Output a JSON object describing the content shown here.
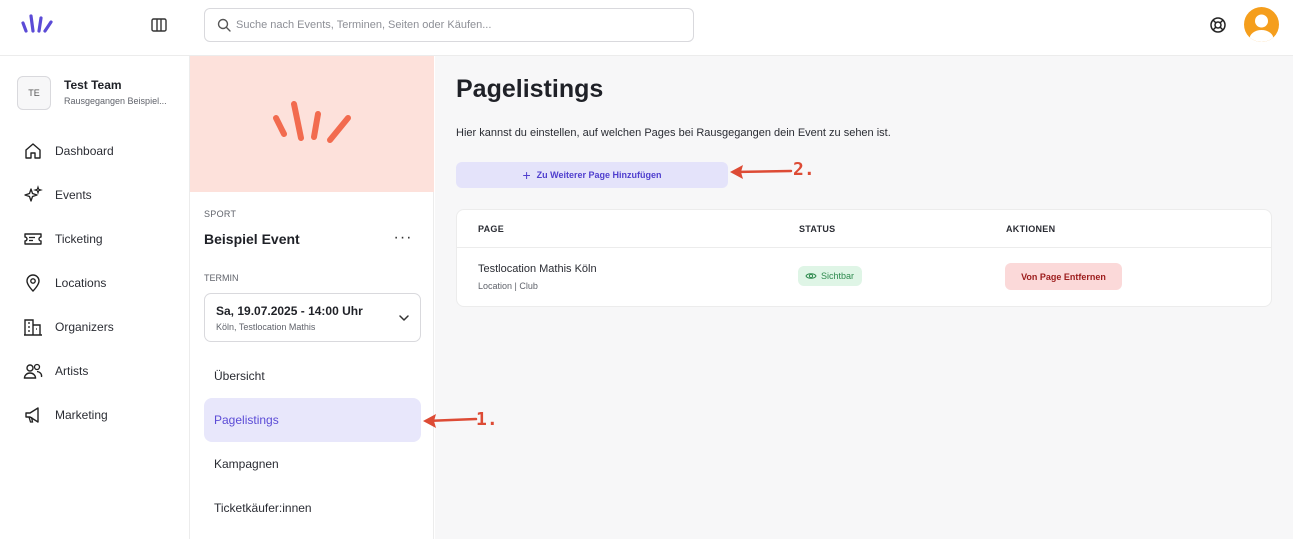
{
  "search": {
    "placeholder": "Suche nach Events, Terminen, Seiten oder Käufen..."
  },
  "team": {
    "badge": "TE",
    "name": "Test Team",
    "subtitle": "Rausgegangen Beispiel..."
  },
  "sidebar": {
    "items": [
      {
        "label": "Dashboard",
        "icon": "home-icon"
      },
      {
        "label": "Events",
        "icon": "sparkles-icon"
      },
      {
        "label": "Ticketing",
        "icon": "ticket-icon"
      },
      {
        "label": "Locations",
        "icon": "map-pin-icon"
      },
      {
        "label": "Organizers",
        "icon": "building-icon"
      },
      {
        "label": "Artists",
        "icon": "users-icon"
      },
      {
        "label": "Marketing",
        "icon": "megaphone-icon"
      }
    ]
  },
  "event": {
    "category": "SPORT",
    "name": "Beispiel Event",
    "more": "···",
    "termin_label": "TERMIN",
    "termin_date": "Sa, 19.07.2025 - 14:00 Uhr",
    "termin_location": "Köln, Testlocation Mathis",
    "subnav": [
      {
        "label": "Übersicht",
        "active": false
      },
      {
        "label": "Pagelistings",
        "active": true
      },
      {
        "label": "Kampagnen",
        "active": false
      },
      {
        "label": "Ticketkäufer:innen",
        "active": false
      }
    ]
  },
  "main": {
    "title": "Pagelistings",
    "description": "Hier kannst du einstellen, auf welchen Pages bei Rausgegangen dein Event zu sehen ist.",
    "add_button": "Zu Weiterer Page Hinzufügen",
    "table": {
      "headers": {
        "page": "PAGE",
        "status": "STATUS",
        "actions": "AKTIONEN"
      },
      "rows": [
        {
          "name": "Testlocation Mathis Köln",
          "sub": "Location | Club",
          "status": "Sichtbar",
          "action": "Von Page Entfernen"
        }
      ]
    }
  },
  "annotations": {
    "one": "1.",
    "two": "2."
  },
  "colors": {
    "accent": "#5b4bd6",
    "brand_orange": "#f26b4f",
    "annotation_red": "#dd4b35",
    "hero_bg": "#fde1db"
  }
}
